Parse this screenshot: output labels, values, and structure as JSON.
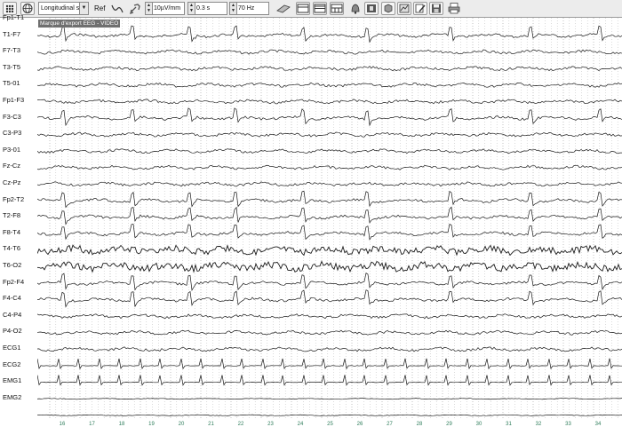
{
  "toolbar": {
    "montage": "Longitudinal std",
    "ref_label": "Ref",
    "sensitivity": "10µV/mm",
    "time_constant": "0.3 s",
    "filter": "70 Hz"
  },
  "marker_label": "Marque d'export EEG - VIDEO",
  "channels": [
    "Fp1-T1",
    "T1-F7",
    "F7-T3",
    "T3-T5",
    "T5-01",
    "Fp1-F3",
    "F3-C3",
    "C3-P3",
    "P3-01",
    "Fz-Cz",
    "Cz-Pz",
    "Fp2-T2",
    "T2-F8",
    "F8-T4",
    "T4-T6",
    "T6-O2",
    "Fp2-F4",
    "F4-C4",
    "C4-P4",
    "P4-O2",
    "ECG1",
    "ECG2",
    "EMG1",
    "EMG2"
  ],
  "seconds": [
    "16",
    "17",
    "18",
    "19",
    "20",
    "21",
    "22",
    "23",
    "24",
    "25",
    "26",
    "27",
    "28",
    "29",
    "30",
    "31",
    "32",
    "33",
    "34"
  ],
  "colors": {
    "trace": "#1a1a1a",
    "grid": "#9a9a9a",
    "seconds": "#2e7d5b",
    "marker_bg": "#6f6f6f"
  }
}
